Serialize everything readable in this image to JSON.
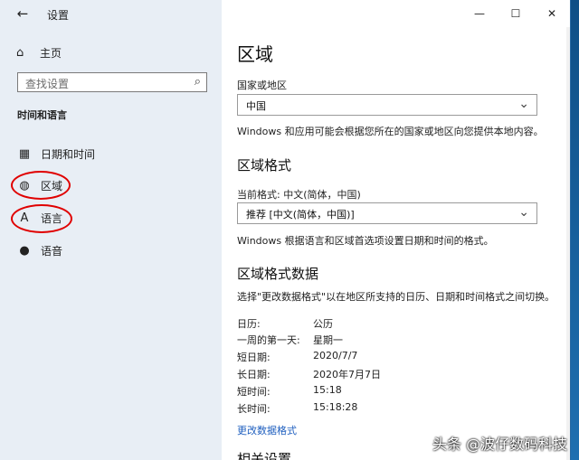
{
  "window": {
    "title": "设置",
    "controls": {
      "minimize": "—",
      "maximize": "☐",
      "close": "✕"
    }
  },
  "sidebar": {
    "home_label": "主页",
    "search_placeholder": "查找设置",
    "section_title": "时间和语言",
    "items": [
      {
        "label": "日期和时间",
        "icon": "calendar-clock-icon"
      },
      {
        "label": "区域",
        "icon": "globe-icon"
      },
      {
        "label": "语言",
        "icon": "language-icon"
      },
      {
        "label": "语音",
        "icon": "microphone-icon"
      }
    ]
  },
  "main": {
    "title": "区域",
    "country": {
      "label": "国家或地区",
      "value": "中国",
      "description": "Windows 和应用可能会根据您所在的国家或地区向您提供本地内容。"
    },
    "format": {
      "heading": "区域格式",
      "current_label": "当前格式: 中文(简体，中国)",
      "value": "推荐 [中文(简体，中国)]",
      "description": "Windows 根据语言和区域首选项设置日期和时间的格式。"
    },
    "format_data": {
      "heading": "区域格式数据",
      "description": "选择\"更改数据格式\"以在地区所支持的日历、日期和时间格式之间切换。",
      "rows": [
        {
          "key": "日历:",
          "value": "公历"
        },
        {
          "key": "一周的第一天:",
          "value": "星期一"
        },
        {
          "key": "短日期:",
          "value": "2020/7/7"
        },
        {
          "key": "长日期:",
          "value": "2020年7月7日"
        },
        {
          "key": "短时间:",
          "value": "15:18"
        },
        {
          "key": "长时间:",
          "value": "15:18:28"
        }
      ],
      "link": "更改数据格式"
    },
    "next_heading": "相关设置"
  },
  "watermark": "头条 @波仔数码科技",
  "colors": {
    "sidebar_bg": "#e8eef5",
    "accent_link": "#1f5fbf",
    "annotation_red": "#e00000"
  }
}
